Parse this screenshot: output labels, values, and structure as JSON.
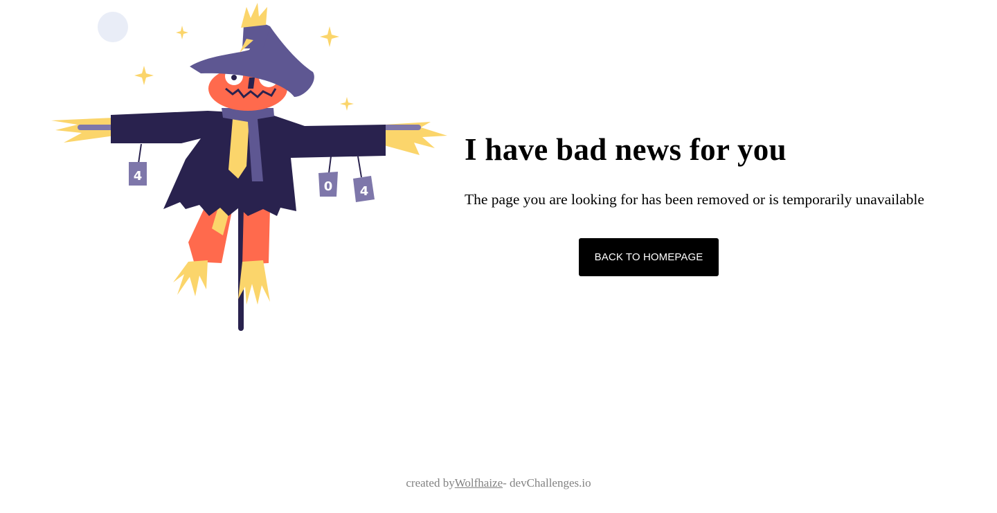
{
  "illustration": {
    "subject": "scarecrow-404-illustration",
    "cans": [
      "4",
      "0",
      "4"
    ],
    "colors": {
      "hat": "#5E5792",
      "coat": "#29224E",
      "face": "#FF6A4D",
      "straw": "#FBD56B",
      "scarf": "#5E5792",
      "pole": "#29224E",
      "moon": "#E9EDF7",
      "can": "#7E77AA"
    }
  },
  "main": {
    "headline": "I have bad news for you",
    "message": "The page you are looking for has been removed or is temporarily unavailable",
    "button_label": "BACK TO HOMEPAGE"
  },
  "footer": {
    "prefix": "created by",
    "author": "Wolfhaize",
    "suffix": "- devChallenges.io"
  },
  "theme": {
    "background": "#FFFFFF",
    "text": "#000000",
    "button_bg": "#000000",
    "button_text": "#FFFFFF",
    "footer_text": "#828282"
  }
}
